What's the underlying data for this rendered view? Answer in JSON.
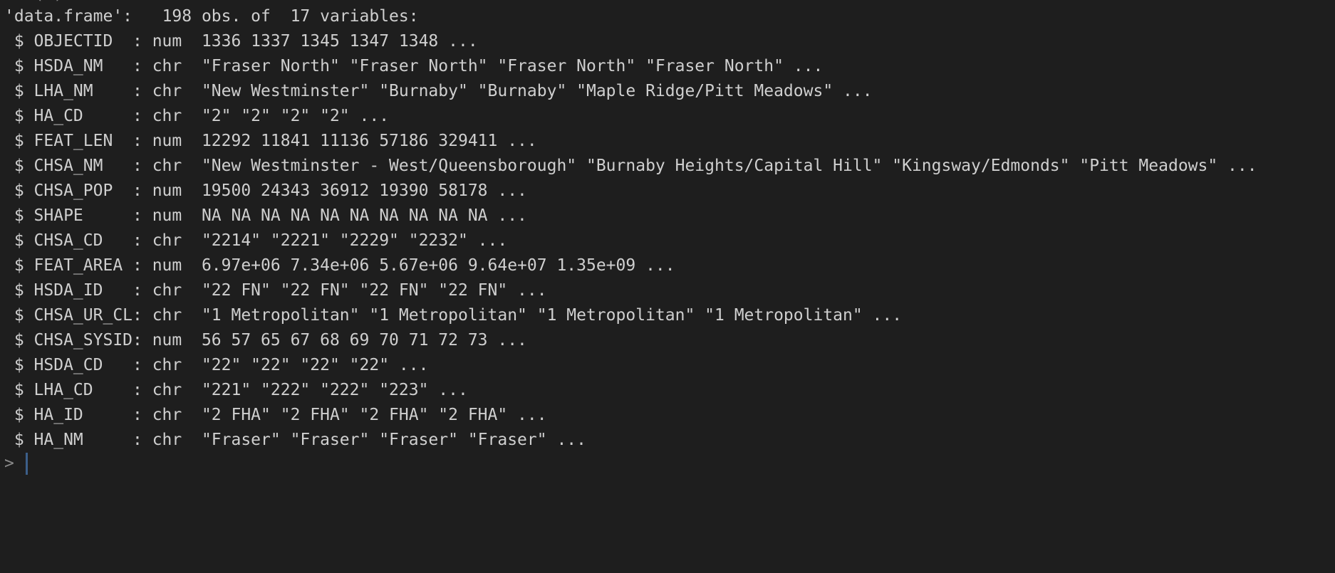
{
  "console": {
    "previous_fragment": "str(d)",
    "header": "'data.frame':\t198 obs. of  17 variables:",
    "rows": [
      " $ OBJECTID  : num  1336 1337 1345 1347 1348 ...",
      " $ HSDA_NM   : chr  \"Fraser North\" \"Fraser North\" \"Fraser North\" \"Fraser North\" ...",
      " $ LHA_NM    : chr  \"New Westminster\" \"Burnaby\" \"Burnaby\" \"Maple Ridge/Pitt Meadows\" ...",
      " $ HA_CD     : chr  \"2\" \"2\" \"2\" \"2\" ...",
      " $ FEAT_LEN  : num  12292 11841 11136 57186 329411 ...",
      " $ CHSA_NM   : chr  \"New Westminster - West/Queensborough\" \"Burnaby Heights/Capital Hill\" \"Kingsway/Edmonds\" \"Pitt Meadows\" ...",
      " $ CHSA_POP  : num  19500 24343 36912 19390 58178 ...",
      " $ SHAPE     : num  NA NA NA NA NA NA NA NA NA NA ...",
      " $ CHSA_CD   : chr  \"2214\" \"2221\" \"2229\" \"2232\" ...",
      " $ FEAT_AREA : num  6.97e+06 7.34e+06 5.67e+06 9.64e+07 1.35e+09 ...",
      " $ HSDA_ID   : chr  \"22 FN\" \"22 FN\" \"22 FN\" \"22 FN\" ...",
      " $ CHSA_UR_CL: chr  \"1 Metropolitan\" \"1 Metropolitan\" \"1 Metropolitan\" \"1 Metropolitan\" ...",
      " $ CHSA_SYSID: num  56 57 65 67 68 69 70 71 72 73 ...",
      " $ HSDA_CD   : chr  \"22\" \"22\" \"22\" \"22\" ...",
      " $ LHA_CD    : chr  \"221\" \"222\" \"222\" \"223\" ...",
      " $ HA_ID     : chr  \"2 FHA\" \"2 FHA\" \"2 FHA\" \"2 FHA\" ...",
      " $ HA_NM     : chr  \"Fraser\" \"Fraser\" \"Fraser\" \"Fraser\" ..."
    ],
    "prompt": ">"
  }
}
